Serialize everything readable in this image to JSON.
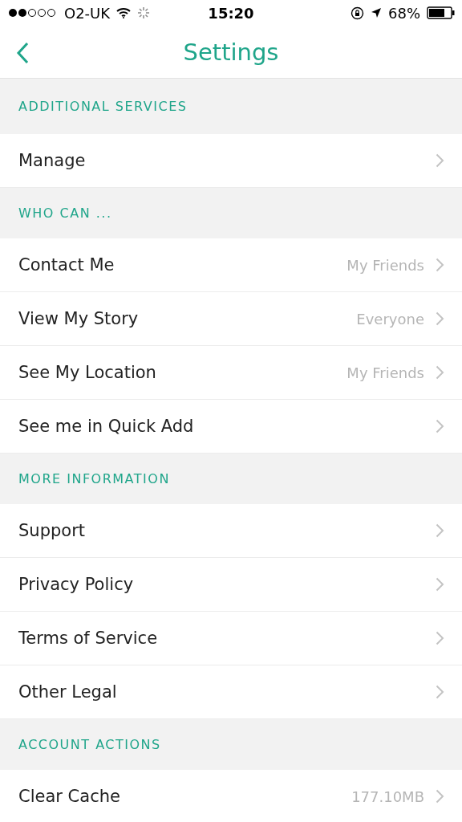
{
  "status_bar": {
    "carrier": "O2-UK",
    "time": "15:20",
    "battery": "68%"
  },
  "nav": {
    "title": "Settings"
  },
  "sections": [
    {
      "header": "ADDITIONAL SERVICES",
      "rows": [
        {
          "label": "Manage"
        }
      ]
    },
    {
      "header": "WHO CAN ...",
      "rows": [
        {
          "label": "Contact Me",
          "value": "My Friends"
        },
        {
          "label": "View My Story",
          "value": "Everyone"
        },
        {
          "label": "See My Location",
          "value": "My Friends"
        },
        {
          "label": "See me in Quick Add"
        }
      ]
    },
    {
      "header": "MORE INFORMATION",
      "rows": [
        {
          "label": "Support"
        },
        {
          "label": "Privacy Policy"
        },
        {
          "label": "Terms of Service"
        },
        {
          "label": "Other Legal"
        }
      ]
    },
    {
      "header": "ACCOUNT ACTIONS",
      "rows": [
        {
          "label": "Clear Cache",
          "value": "177.10MB"
        }
      ]
    }
  ]
}
